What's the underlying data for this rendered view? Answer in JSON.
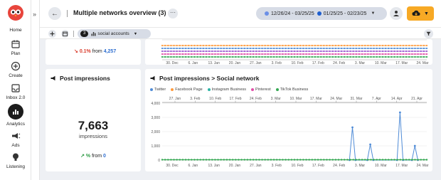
{
  "nav": {
    "items": [
      {
        "label": "Home",
        "icon": "home-owl-icon"
      },
      {
        "label": "Plan",
        "icon": "calendar-icon"
      },
      {
        "label": "Create",
        "icon": "plus-circle-icon"
      },
      {
        "label": "Inbox 2.0",
        "icon": "inbox-icon"
      },
      {
        "label": "Analytics",
        "icon": "bar-chart-icon"
      },
      {
        "label": "Ads",
        "icon": "megaphone-icon"
      },
      {
        "label": "Listening",
        "icon": "lightbulb-icon"
      }
    ],
    "collapse_glyph": "»"
  },
  "header": {
    "back_glyph": "←",
    "title": "Multiple networks overview (3)",
    "more_glyph": "···",
    "date_range_primary": "12/26/24 - 03/25/25",
    "date_range_compare": "01/25/25 - 02/23/25",
    "color_primary": "#6b8fe6",
    "color_compare": "#1f5fcf",
    "accent": "#f7a925"
  },
  "filterbar": {
    "social_count": "3",
    "social_label": "social accounts"
  },
  "top_metric": {
    "change": "0.1%",
    "from_word": "from",
    "previous": "4,257"
  },
  "impressions_card": {
    "title": "Post impressions",
    "value": "7,663",
    "unit": "impressions",
    "change": "%",
    "from_word": "from",
    "previous": "0"
  },
  "network_card": {
    "title": "Post impressions > Social network"
  },
  "chart_data": [
    {
      "type": "line",
      "x": [
        "30. Dec",
        "6. Jan",
        "13. Jan",
        "20. Jan",
        "27. Jan",
        "3. Feb",
        "10. Feb",
        "17. Feb",
        "24. Feb",
        "3. Mar",
        "10. Mar",
        "17. Mar",
        "24. Mar"
      ],
      "series": [
        {
          "color": "#ff9a3c",
          "values": [
            0,
            0,
            0,
            0,
            0,
            0,
            0,
            0,
            0,
            0,
            0,
            0,
            0
          ]
        },
        {
          "color": "#4f8bd6",
          "values": [
            0,
            0,
            0,
            0,
            0,
            0,
            0,
            0,
            0,
            0,
            0,
            0,
            0
          ]
        },
        {
          "color": "#9b59d0",
          "values": [
            0,
            0,
            0,
            0,
            0,
            0,
            0,
            0,
            0,
            0,
            0,
            0,
            0
          ]
        },
        {
          "color": "#e14ea8",
          "values": [
            0,
            0,
            0,
            0,
            0,
            0,
            0,
            0,
            0,
            0,
            0,
            0,
            0
          ]
        },
        {
          "color": "#35a853",
          "values": [
            0,
            0,
            0,
            0,
            0,
            0,
            0,
            0,
            0,
            0,
            0,
            0,
            0
          ]
        }
      ]
    },
    {
      "type": "line",
      "title": "Post impressions > Social network",
      "x_top": [
        "27. Jan",
        "3. Feb",
        "10. Feb",
        "17. Feb",
        "24. Feb",
        "3. Mar",
        "10. Mar",
        "17. Mar",
        "24. Mar",
        "31. Mar",
        "7. Apr",
        "14. Apr",
        "21. Apr"
      ],
      "x": [
        "30. Dec",
        "6. Jan",
        "13. Jan",
        "20. Jan",
        "27. Jan",
        "3. Feb",
        "10. Feb",
        "17. Feb",
        "24. Feb",
        "3. Mar",
        "10. Mar",
        "17. Mar",
        "24. Mar"
      ],
      "x_range": [
        "2024-12-26",
        "2025-03-25"
      ],
      "y_ticks": [
        "0",
        "1,000",
        "2,000",
        "3,000",
        "4,000"
      ],
      "ylim": [
        0,
        4000
      ],
      "series": [
        {
          "name": "Twitter",
          "color": "#4f8bd6",
          "points": [
            [
              "2025-02-27",
              0
            ],
            [
              "2025-02-28",
              2300
            ],
            [
              "2025-03-01",
              0
            ],
            [
              "2025-03-05",
              0
            ],
            [
              "2025-03-06",
              1100
            ],
            [
              "2025-03-07",
              0
            ],
            [
              "2025-03-15",
              0
            ],
            [
              "2025-03-16",
              3350
            ],
            [
              "2025-03-17",
              0
            ],
            [
              "2025-03-20",
              0
            ],
            [
              "2025-03-21",
              1000
            ],
            [
              "2025-03-22",
              0
            ]
          ]
        },
        {
          "name": "Facebook Page",
          "color": "#ff9a3c",
          "points": []
        },
        {
          "name": "Instagram Business",
          "color": "#2bb3a5",
          "points": []
        },
        {
          "name": "Pinterest",
          "color": "#e14ea8",
          "points": []
        },
        {
          "name": "TikTok Business",
          "color": "#35a853",
          "points": [
            [
              "2024-12-26",
              0
            ],
            [
              "2025-03-25",
              0
            ]
          ]
        }
      ]
    }
  ]
}
